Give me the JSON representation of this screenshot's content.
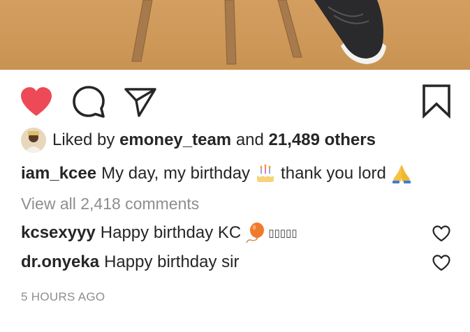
{
  "post": {
    "liked_by_prefix": "Liked by",
    "liked_by_user": "emoney_team",
    "and_text": "and",
    "others_count": "21,489 others",
    "caption_user": "iam_kcee",
    "caption_text_1": "My day, my birthday",
    "caption_text_2": "thank you lord",
    "view_all_comments": "View all 2,418 comments",
    "comments": [
      {
        "user": "kcsexyyy",
        "text": "Happy birthday KC",
        "trailing": "▯▯▯▯▯"
      },
      {
        "user": "dr.onyeka",
        "text": "Happy birthday sir"
      }
    ],
    "timestamp": "5 HOURS AGO"
  },
  "colors": {
    "like_red": "#ed4956",
    "text": "#262626",
    "muted": "#8e8e8e"
  },
  "icons": [
    "heart-filled-icon",
    "comment-icon",
    "share-icon",
    "bookmark-icon",
    "birthday-cake-icon",
    "praying-hands-icon",
    "balloon-icon",
    "heart-outline-icon"
  ]
}
